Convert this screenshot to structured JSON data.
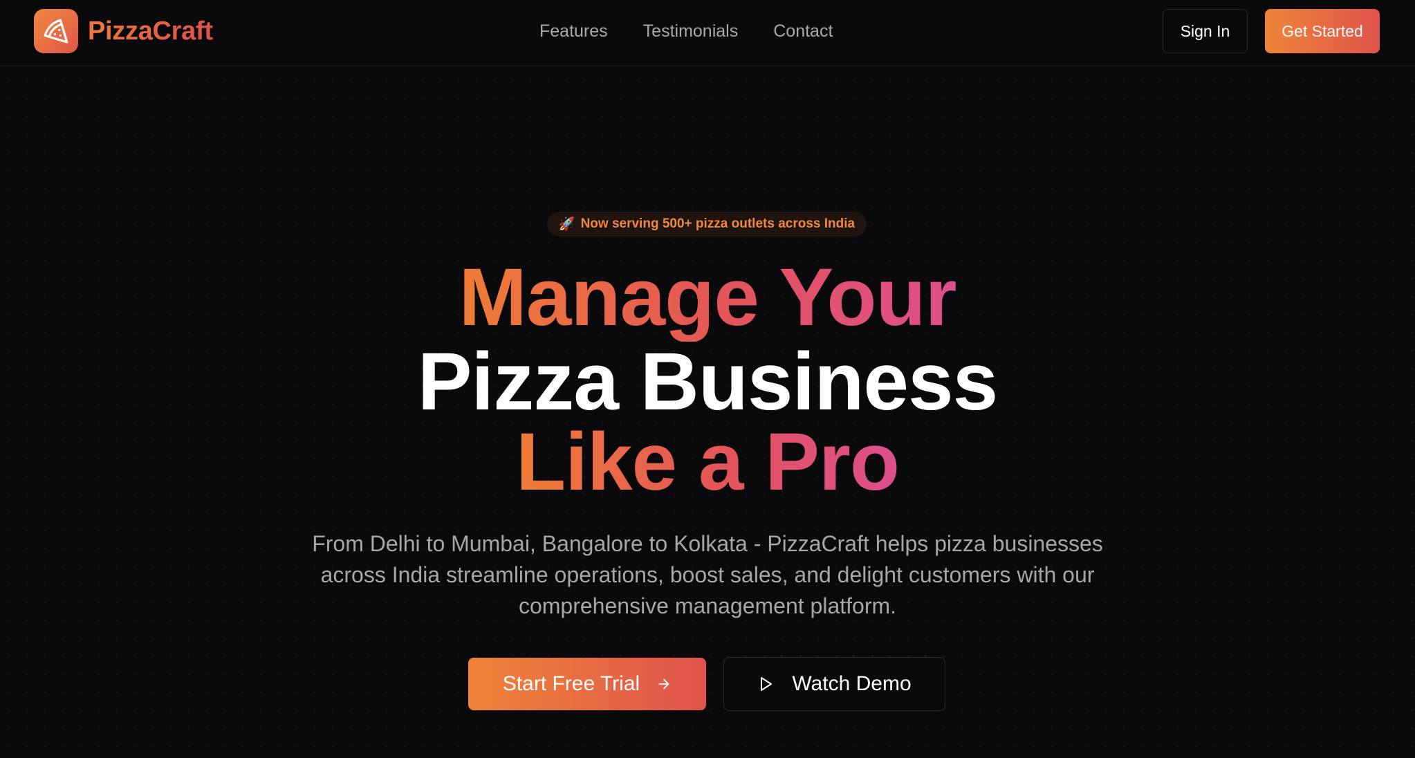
{
  "brand": {
    "name": "PizzaCraft",
    "icon": "pizza-slice-icon",
    "accent_start": "#ee8539",
    "accent_end": "#e0534c",
    "accent_pink": "#dd4f8e"
  },
  "nav": {
    "links": [
      "Features",
      "Testimonials",
      "Contact"
    ],
    "sign_in": "Sign In",
    "get_started": "Get Started"
  },
  "hero": {
    "badge_icon": "🚀",
    "badge_text": "Now serving 500+ pizza outlets across India",
    "headline_line1": "Manage Your",
    "headline_line2": "Pizza Business",
    "headline_line3": "Like a Pro",
    "subtext": "From Delhi to Mumbai, Bangalore to Kolkata - PizzaCraft helps pizza businesses across India streamline operations, boost sales, and delight customers with our comprehensive management platform.",
    "primary_cta": "Start Free Trial",
    "primary_cta_icon": "arrow-right-icon",
    "secondary_cta": "Watch Demo",
    "secondary_cta_icon": "play-icon"
  }
}
